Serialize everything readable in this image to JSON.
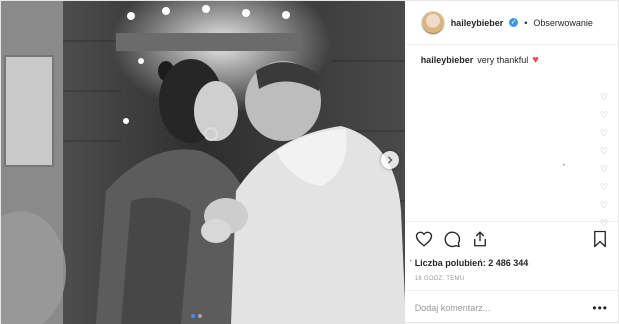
{
  "header": {
    "username": "haileybieber",
    "separator": "•",
    "follow_label": "Obserwowanie"
  },
  "caption": {
    "username": "haileybieber",
    "text": "very thankful"
  },
  "likes": {
    "label": "Liczba polubień:",
    "count": "2 486 344"
  },
  "timestamp": "16 GODZ. TEMU",
  "comment": {
    "placeholder": "Dodaj komentarz..."
  },
  "carousel": {
    "slide_count": 2,
    "active_slide": 1
  },
  "colors": {
    "verified": "#3897f0",
    "heart": "#ed4956",
    "text": "#262626",
    "muted": "#999999"
  },
  "icons": [
    "heart-icon",
    "comment-icon",
    "share-icon",
    "bookmark-icon",
    "verified-icon",
    "chevron-right-icon",
    "more-icon"
  ]
}
